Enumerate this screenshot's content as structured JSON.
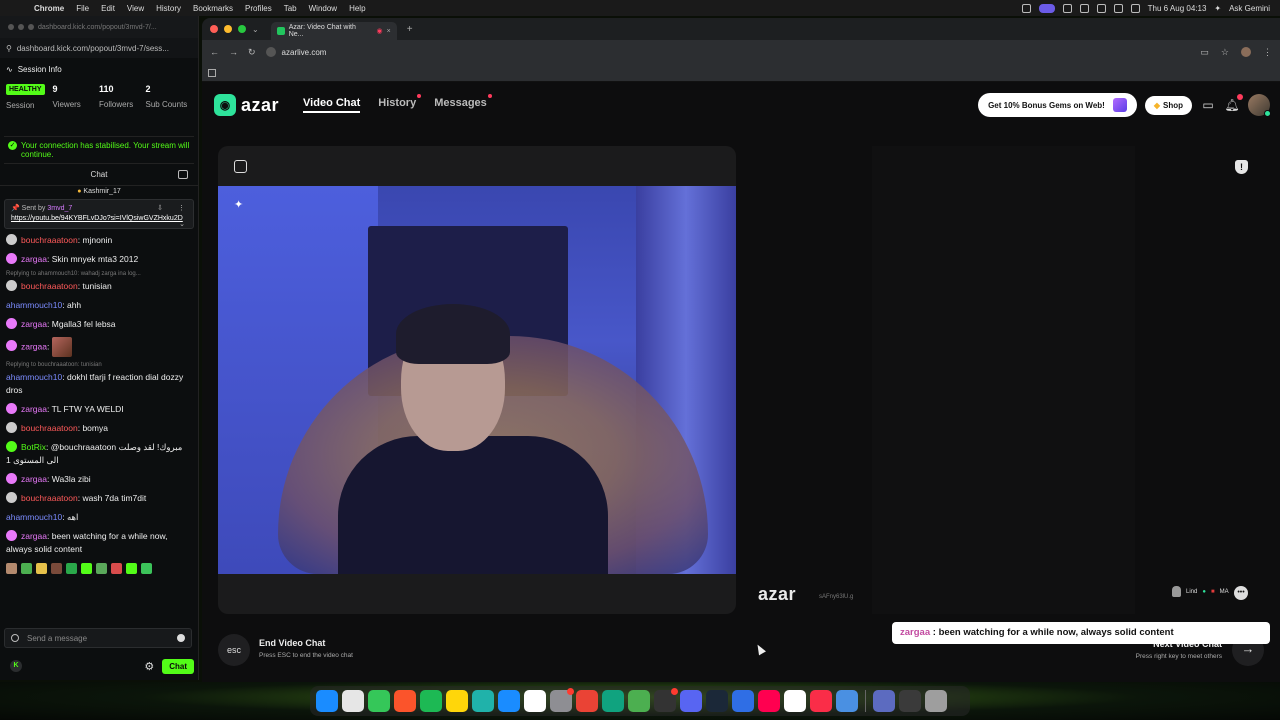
{
  "menubar": {
    "app": "Chrome",
    "items": [
      "File",
      "Edit",
      "View",
      "History",
      "Bookmarks",
      "Profiles",
      "Tab",
      "Window",
      "Help"
    ],
    "datetime": "Thu 6 Aug 04:13",
    "assistant": "Ask Gemini"
  },
  "kick": {
    "tab_url": "dashboard.kick.com/popout/3mvd-7/...",
    "url": "dashboard.kick.com/popout/3mvd-7/sess...",
    "session_title": "Session Info",
    "health": "HEALTHY",
    "stats": [
      {
        "value": "",
        "label": "Session",
        "badge": "HEALTHY"
      },
      {
        "value": "9",
        "label": "Viewers"
      },
      {
        "value": "110",
        "label": "Followers"
      },
      {
        "value": "2",
        "label": "Sub Counts"
      }
    ],
    "notice": "Your connection has stabilised. Your stream will continue.",
    "chat_title": "Chat",
    "pinned_top": "Kashmir_17",
    "pinned": {
      "sent_by_label": "Sent by",
      "sender": "3mvd_7",
      "link": "https://youtu.be/94KYBFLvDJo?si=IVlQsiwGVZHxku2D"
    },
    "messages": [
      {
        "user": "bouchraaatoon",
        "text": "mjnonin",
        "color": "#ff5a5a",
        "badge": "#cccccc"
      },
      {
        "user": "zargaa",
        "text": "Skin mnyek mta3 2012",
        "color": "#e879f9",
        "badge": "#e879f9"
      },
      {
        "reply": "Replying to ahammouch10: wahadj zarga ina log..."
      },
      {
        "user": "bouchraaatoon",
        "text": "tunisian",
        "color": "#ff5a5a",
        "badge": "#cccccc"
      },
      {
        "user": "ahammouch10",
        "text": "ahh",
        "color": "#7c8cff"
      },
      {
        "user": "zargaa",
        "text": "Mgalla3 fel lebsa",
        "color": "#e879f9",
        "badge": "#e879f9"
      },
      {
        "user": "zargaa",
        "text": "",
        "emote": true,
        "color": "#e879f9",
        "badge": "#e879f9"
      },
      {
        "reply": "Replying to bouchraaatoon: tunisian"
      },
      {
        "user": "ahammouch10",
        "text": "dokhl tfarji f reaction dial dozzy dros",
        "color": "#7c8cff"
      },
      {
        "user": "zargaa",
        "text": "TL FTW YA WELDI",
        "color": "#e879f9",
        "badge": "#e879f9"
      },
      {
        "user": "bouchraaatoon",
        "text": "bomya",
        "color": "#ff5a5a",
        "badge": "#cccccc"
      },
      {
        "user": "BotRix",
        "text": "@bouchraaatoon مبروك! لقد وصلت الى المستوى 1",
        "color": "#53fc18",
        "badge": "#53fc18"
      },
      {
        "user": "zargaa",
        "text": "Wa3la zibi",
        "color": "#e879f9",
        "badge": "#e879f9"
      },
      {
        "user": "bouchraaatoon",
        "text": "wash 7da tim7dit",
        "color": "#ff5a5a",
        "badge": "#cccccc"
      },
      {
        "user": "ahammouch10",
        "text": "اهه",
        "color": "#7c8cff"
      },
      {
        "user": "zargaa",
        "text": "been watching for a while now, always solid content",
        "color": "#e879f9",
        "badge": "#e879f9"
      }
    ],
    "composer_placeholder": "Send a message",
    "chat_button": "Chat"
  },
  "chrome": {
    "tab_title": "Azar: Video Chat with Ne...",
    "url": "azarlive.com"
  },
  "azar": {
    "logo": "azar",
    "nav": [
      {
        "label": "Video Chat",
        "active": true
      },
      {
        "label": "History",
        "dot": true
      },
      {
        "label": "Messages",
        "dot": true
      }
    ],
    "bonus_label": "Get 10% Bonus Gems on Web!",
    "shop_label": "Shop",
    "watermark": "azar",
    "watermark_id": "sAFny63lU.g",
    "remote_user": "Lind",
    "remote_country": "MA",
    "end_title": "End Video Chat",
    "end_sub": "Press ESC to end the video chat",
    "esc_label": "esc",
    "next_title": "Next Video Chat",
    "next_sub": "Press right key to meet others"
  },
  "overlay": {
    "user": "zargaa",
    "separator": " : ",
    "text": "been watching for a while now, always solid content"
  },
  "dock_colors": [
    "#1a8cff",
    "#e6e6e6",
    "#35c759",
    "#fb542b",
    "#1db954",
    "#ffd60a",
    "#20b2aa",
    "#1a8cff",
    "#ffffff",
    "#8e8e93",
    "#ea4335",
    "#10a37f",
    "#4caf50",
    "#333333",
    "#5865f2",
    "#1b2838",
    "#2f6ee5",
    "#ff0050",
    "#ffffff",
    "#fa2d48",
    "#4a90e2",
    "#5c6bc0",
    "#3a3a3a",
    "#9e9e9e"
  ]
}
